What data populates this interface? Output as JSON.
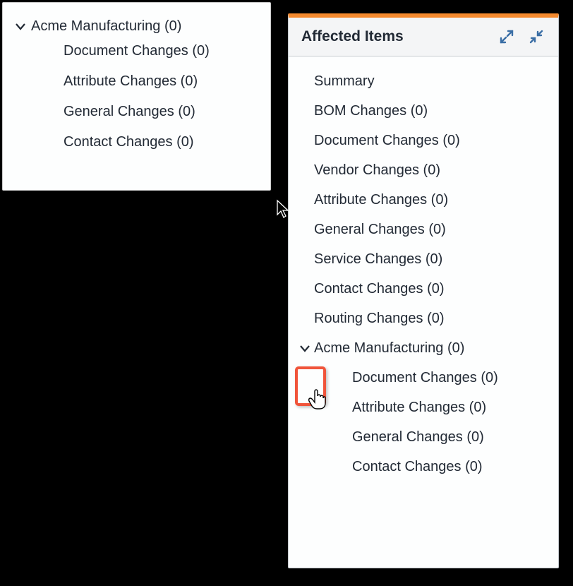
{
  "leftTree": {
    "root": {
      "label": "Acme Manufacturing",
      "count": 0
    },
    "children": [
      {
        "label": "Document Changes",
        "count": 0
      },
      {
        "label": "Attribute Changes",
        "count": 0
      },
      {
        "label": "General Changes",
        "count": 0
      },
      {
        "label": "Contact Changes",
        "count": 0
      }
    ]
  },
  "rightPanel": {
    "title": "Affected Items",
    "items": [
      {
        "label": "Summary",
        "count": null
      },
      {
        "label": "BOM Changes",
        "count": 0
      },
      {
        "label": "Document Changes",
        "count": 0
      },
      {
        "label": "Vendor Changes",
        "count": 0
      },
      {
        "label": "Attribute Changes",
        "count": 0
      },
      {
        "label": "General Changes",
        "count": 0
      },
      {
        "label": "Service Changes",
        "count": 0
      },
      {
        "label": "Contact Changes",
        "count": 0
      },
      {
        "label": "Routing Changes",
        "count": 0
      }
    ],
    "nested": {
      "root": {
        "label": "Acme Manufacturing",
        "count": 0
      },
      "children": [
        {
          "label": "Document Changes",
          "count": 0
        },
        {
          "label": "Attribute Changes",
          "count": 0
        },
        {
          "label": "General Changes",
          "count": 0
        },
        {
          "label": "Contact Changes",
          "count": 0
        }
      ]
    }
  }
}
